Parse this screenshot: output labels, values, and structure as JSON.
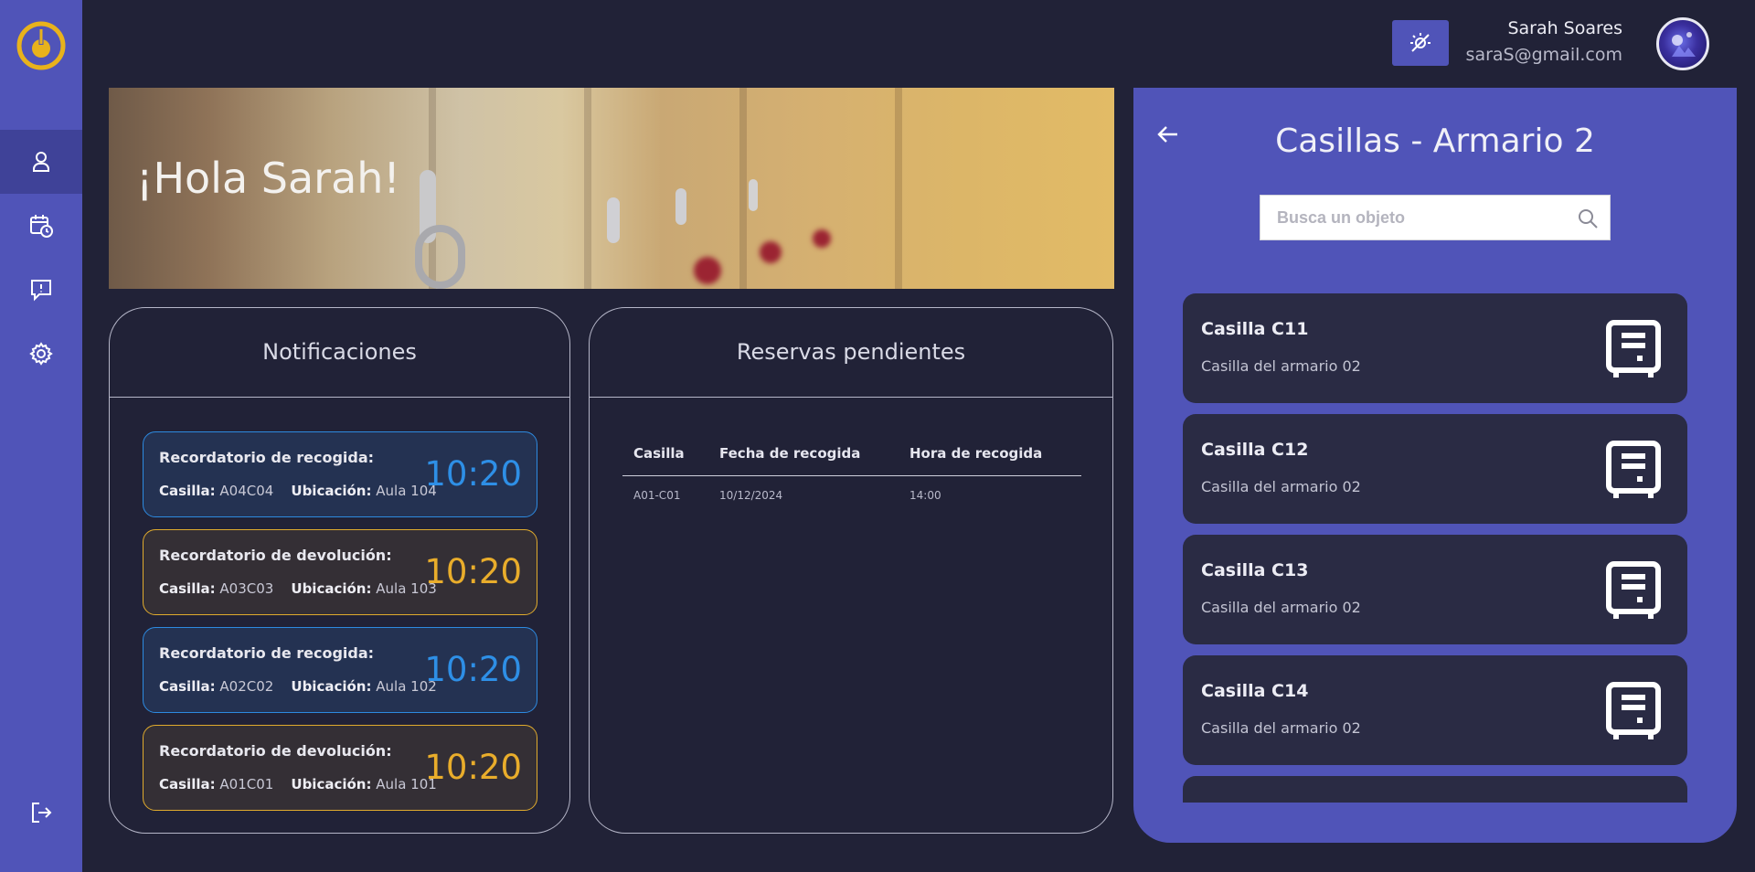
{
  "header": {
    "user_name": "Sarah Soares",
    "user_email": "saraS@gmail.com"
  },
  "sidebar": {
    "items": [
      {
        "name": "profile",
        "icon": "user-icon",
        "active": true
      },
      {
        "name": "reservations",
        "icon": "calendar-clock-icon",
        "active": false
      },
      {
        "name": "incidents",
        "icon": "message-alert-icon",
        "active": false
      },
      {
        "name": "settings",
        "icon": "gear-icon",
        "active": false
      }
    ],
    "logout_icon": "logout-icon"
  },
  "banner": {
    "greeting": "¡Hola Sarah!"
  },
  "notifications": {
    "title": "Notificaciones",
    "casilla_label": "Casilla:",
    "ubicacion_label": "Ubicación:",
    "items": [
      {
        "type": "pickup",
        "title": "Recordatorio de recogida:",
        "casilla": "A04C04",
        "ubicacion": "Aula 104",
        "time": "10:20"
      },
      {
        "type": "return",
        "title": "Recordatorio de devolución:",
        "casilla": "A03C03",
        "ubicacion": "Aula 103",
        "time": "10:20"
      },
      {
        "type": "pickup",
        "title": "Recordatorio de recogida:",
        "casilla": "A02C02",
        "ubicacion": "Aula 102",
        "time": "10:20"
      },
      {
        "type": "return",
        "title": "Recordatorio de devolución:",
        "casilla": "A01C01",
        "ubicacion": "Aula 101",
        "time": "10:20"
      }
    ]
  },
  "reservations": {
    "title": "Reservas pendientes",
    "columns": [
      "Casilla",
      "Fecha de recogida",
      "Hora de recogida"
    ],
    "rows": [
      [
        "A01-C01",
        "10/12/2024",
        "14:00"
      ]
    ]
  },
  "panel": {
    "title": "Casillas - Armario 2",
    "search_placeholder": "Busca un objeto",
    "lockers": [
      {
        "name": "Casilla C11",
        "description": "Casilla del armario 02"
      },
      {
        "name": "Casilla C12",
        "description": "Casilla del armario 02"
      },
      {
        "name": "Casilla C13",
        "description": "Casilla del armario 02"
      },
      {
        "name": "Casilla C14",
        "description": "Casilla del armario 02"
      }
    ]
  },
  "colors": {
    "background": "#212237",
    "accent": "#5054b8",
    "pickup": "#2e8fe6",
    "return": "#e9ad2b",
    "logo": "#e8b21c"
  }
}
